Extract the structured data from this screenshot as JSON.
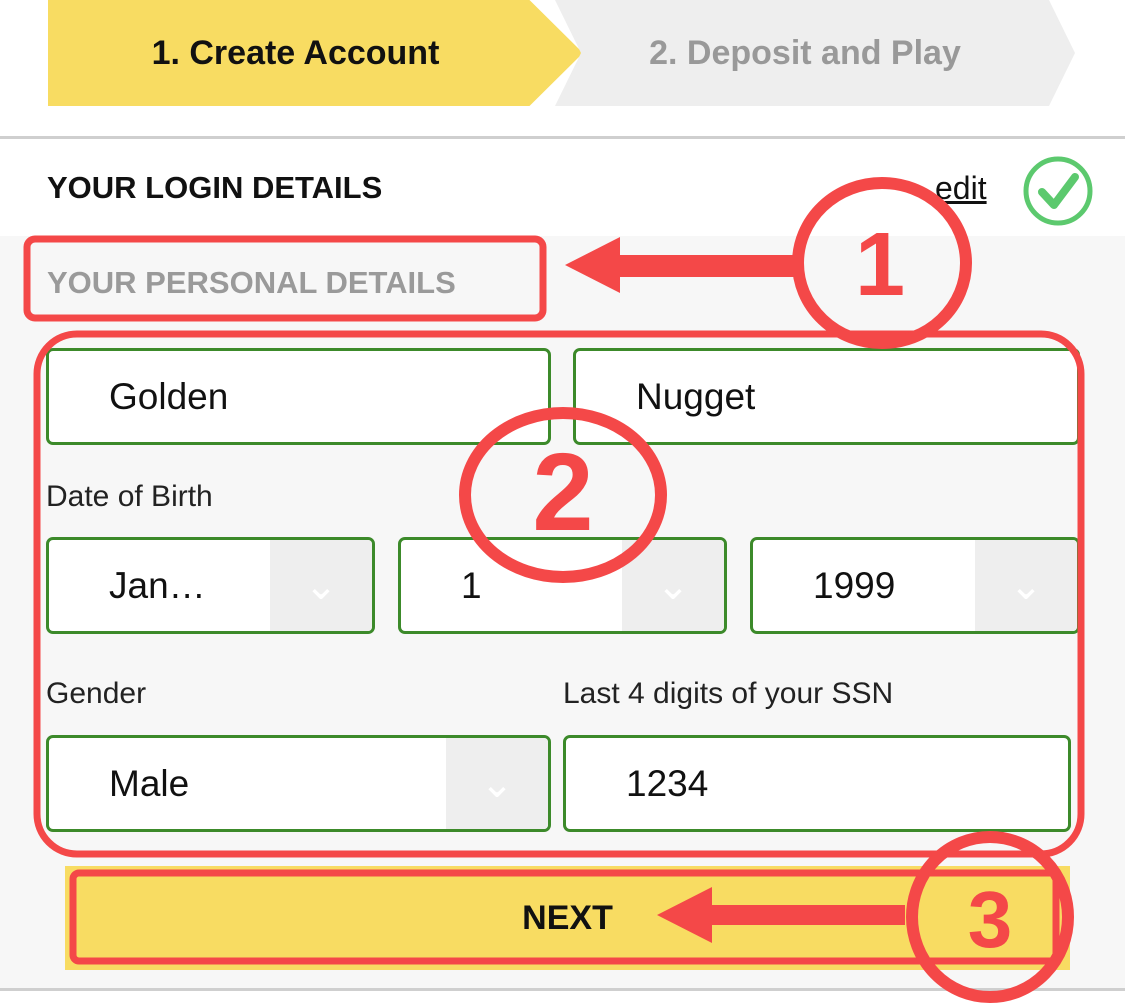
{
  "steps": [
    {
      "label": "1. Create Account",
      "active": true
    },
    {
      "label": "2. Deposit and Play",
      "active": false
    }
  ],
  "login": {
    "title": "YOUR LOGIN DETAILS",
    "edit": "edit",
    "status_icon": "check-circle-icon"
  },
  "personal": {
    "title": "YOUR PERSONAL DETAILS",
    "first_name": "Golden",
    "last_name": "Nugget",
    "dob_label": "Date of Birth",
    "dob_month": "Jan…",
    "dob_day": "1",
    "dob_year": "1999",
    "gender_label": "Gender",
    "gender": "Male",
    "ssn_label": "Last 4 digits of your SSN",
    "ssn": "1234"
  },
  "next_label": "NEXT",
  "annotations": [
    "1",
    "2",
    "3"
  ],
  "colors": {
    "accent": "#f8dc62",
    "border": "#3c8a2a",
    "annotation": "#f44848",
    "check": "#5cc96e"
  }
}
